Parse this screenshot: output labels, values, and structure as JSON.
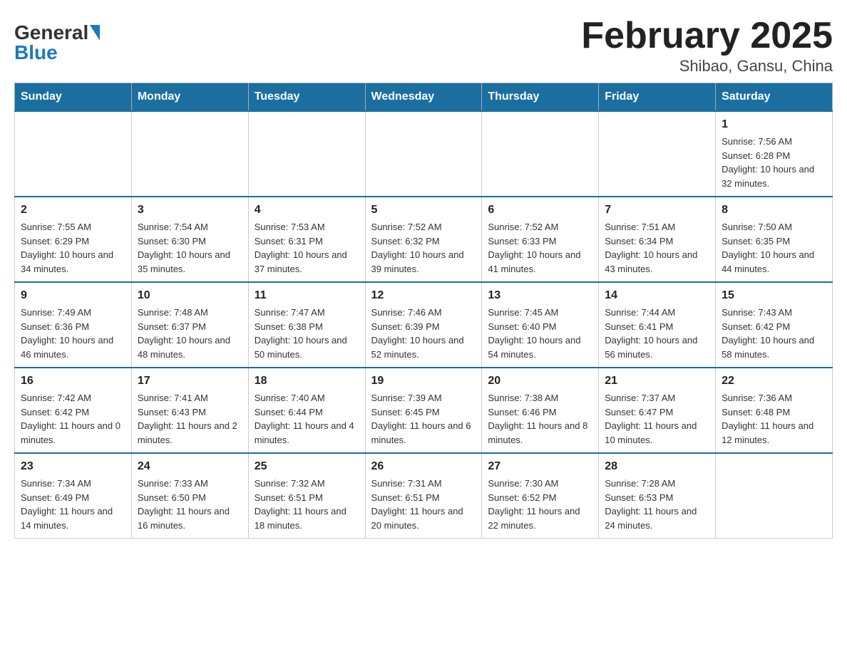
{
  "logo": {
    "text_general": "General",
    "text_blue": "Blue"
  },
  "title": "February 2025",
  "subtitle": "Shibao, Gansu, China",
  "days_of_week": [
    "Sunday",
    "Monday",
    "Tuesday",
    "Wednesday",
    "Thursday",
    "Friday",
    "Saturday"
  ],
  "weeks": [
    [
      {
        "day": "",
        "sunrise": "",
        "sunset": "",
        "daylight": ""
      },
      {
        "day": "",
        "sunrise": "",
        "sunset": "",
        "daylight": ""
      },
      {
        "day": "",
        "sunrise": "",
        "sunset": "",
        "daylight": ""
      },
      {
        "day": "",
        "sunrise": "",
        "sunset": "",
        "daylight": ""
      },
      {
        "day": "",
        "sunrise": "",
        "sunset": "",
        "daylight": ""
      },
      {
        "day": "",
        "sunrise": "",
        "sunset": "",
        "daylight": ""
      },
      {
        "day": "1",
        "sunrise": "Sunrise: 7:56 AM",
        "sunset": "Sunset: 6:28 PM",
        "daylight": "Daylight: 10 hours and 32 minutes."
      }
    ],
    [
      {
        "day": "2",
        "sunrise": "Sunrise: 7:55 AM",
        "sunset": "Sunset: 6:29 PM",
        "daylight": "Daylight: 10 hours and 34 minutes."
      },
      {
        "day": "3",
        "sunrise": "Sunrise: 7:54 AM",
        "sunset": "Sunset: 6:30 PM",
        "daylight": "Daylight: 10 hours and 35 minutes."
      },
      {
        "day": "4",
        "sunrise": "Sunrise: 7:53 AM",
        "sunset": "Sunset: 6:31 PM",
        "daylight": "Daylight: 10 hours and 37 minutes."
      },
      {
        "day": "5",
        "sunrise": "Sunrise: 7:52 AM",
        "sunset": "Sunset: 6:32 PM",
        "daylight": "Daylight: 10 hours and 39 minutes."
      },
      {
        "day": "6",
        "sunrise": "Sunrise: 7:52 AM",
        "sunset": "Sunset: 6:33 PM",
        "daylight": "Daylight: 10 hours and 41 minutes."
      },
      {
        "day": "7",
        "sunrise": "Sunrise: 7:51 AM",
        "sunset": "Sunset: 6:34 PM",
        "daylight": "Daylight: 10 hours and 43 minutes."
      },
      {
        "day": "8",
        "sunrise": "Sunrise: 7:50 AM",
        "sunset": "Sunset: 6:35 PM",
        "daylight": "Daylight: 10 hours and 44 minutes."
      }
    ],
    [
      {
        "day": "9",
        "sunrise": "Sunrise: 7:49 AM",
        "sunset": "Sunset: 6:36 PM",
        "daylight": "Daylight: 10 hours and 46 minutes."
      },
      {
        "day": "10",
        "sunrise": "Sunrise: 7:48 AM",
        "sunset": "Sunset: 6:37 PM",
        "daylight": "Daylight: 10 hours and 48 minutes."
      },
      {
        "day": "11",
        "sunrise": "Sunrise: 7:47 AM",
        "sunset": "Sunset: 6:38 PM",
        "daylight": "Daylight: 10 hours and 50 minutes."
      },
      {
        "day": "12",
        "sunrise": "Sunrise: 7:46 AM",
        "sunset": "Sunset: 6:39 PM",
        "daylight": "Daylight: 10 hours and 52 minutes."
      },
      {
        "day": "13",
        "sunrise": "Sunrise: 7:45 AM",
        "sunset": "Sunset: 6:40 PM",
        "daylight": "Daylight: 10 hours and 54 minutes."
      },
      {
        "day": "14",
        "sunrise": "Sunrise: 7:44 AM",
        "sunset": "Sunset: 6:41 PM",
        "daylight": "Daylight: 10 hours and 56 minutes."
      },
      {
        "day": "15",
        "sunrise": "Sunrise: 7:43 AM",
        "sunset": "Sunset: 6:42 PM",
        "daylight": "Daylight: 10 hours and 58 minutes."
      }
    ],
    [
      {
        "day": "16",
        "sunrise": "Sunrise: 7:42 AM",
        "sunset": "Sunset: 6:42 PM",
        "daylight": "Daylight: 11 hours and 0 minutes."
      },
      {
        "day": "17",
        "sunrise": "Sunrise: 7:41 AM",
        "sunset": "Sunset: 6:43 PM",
        "daylight": "Daylight: 11 hours and 2 minutes."
      },
      {
        "day": "18",
        "sunrise": "Sunrise: 7:40 AM",
        "sunset": "Sunset: 6:44 PM",
        "daylight": "Daylight: 11 hours and 4 minutes."
      },
      {
        "day": "19",
        "sunrise": "Sunrise: 7:39 AM",
        "sunset": "Sunset: 6:45 PM",
        "daylight": "Daylight: 11 hours and 6 minutes."
      },
      {
        "day": "20",
        "sunrise": "Sunrise: 7:38 AM",
        "sunset": "Sunset: 6:46 PM",
        "daylight": "Daylight: 11 hours and 8 minutes."
      },
      {
        "day": "21",
        "sunrise": "Sunrise: 7:37 AM",
        "sunset": "Sunset: 6:47 PM",
        "daylight": "Daylight: 11 hours and 10 minutes."
      },
      {
        "day": "22",
        "sunrise": "Sunrise: 7:36 AM",
        "sunset": "Sunset: 6:48 PM",
        "daylight": "Daylight: 11 hours and 12 minutes."
      }
    ],
    [
      {
        "day": "23",
        "sunrise": "Sunrise: 7:34 AM",
        "sunset": "Sunset: 6:49 PM",
        "daylight": "Daylight: 11 hours and 14 minutes."
      },
      {
        "day": "24",
        "sunrise": "Sunrise: 7:33 AM",
        "sunset": "Sunset: 6:50 PM",
        "daylight": "Daylight: 11 hours and 16 minutes."
      },
      {
        "day": "25",
        "sunrise": "Sunrise: 7:32 AM",
        "sunset": "Sunset: 6:51 PM",
        "daylight": "Daylight: 11 hours and 18 minutes."
      },
      {
        "day": "26",
        "sunrise": "Sunrise: 7:31 AM",
        "sunset": "Sunset: 6:51 PM",
        "daylight": "Daylight: 11 hours and 20 minutes."
      },
      {
        "day": "27",
        "sunrise": "Sunrise: 7:30 AM",
        "sunset": "Sunset: 6:52 PM",
        "daylight": "Daylight: 11 hours and 22 minutes."
      },
      {
        "day": "28",
        "sunrise": "Sunrise: 7:28 AM",
        "sunset": "Sunset: 6:53 PM",
        "daylight": "Daylight: 11 hours and 24 minutes."
      },
      {
        "day": "",
        "sunrise": "",
        "sunset": "",
        "daylight": ""
      }
    ]
  ]
}
